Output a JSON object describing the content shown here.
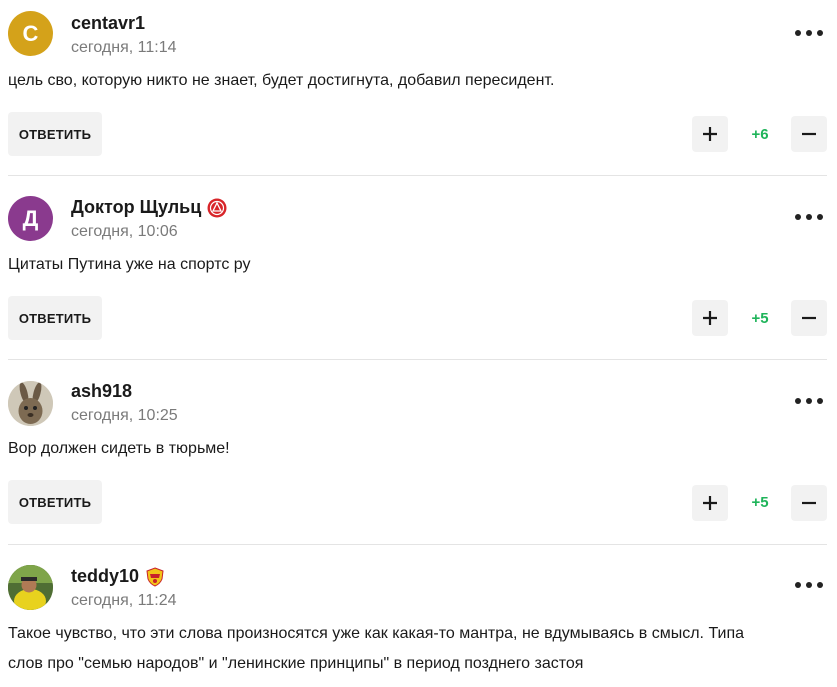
{
  "colors": {
    "accent_green": "#1fb45a",
    "button_bg": "#f2f2f2",
    "muted_text": "#7a7a7a"
  },
  "comments": [
    {
      "avatar_letter": "С",
      "avatar_color": "#d4a21a",
      "username": "centavr1",
      "time": "сегодня, 11:14",
      "text": "цель сво, которую никто не знает, будет достигнута, добавил пересидент.",
      "reply_label": "ОТВЕТИТЬ",
      "score": "+6"
    },
    {
      "avatar_letter": "Д",
      "avatar_color": "#8a3a8e",
      "username": "Доктор Щульц",
      "badge": "red-club-badge-icon",
      "time": "сегодня, 10:06",
      "text": "Цитаты Путина уже на спортс ру",
      "reply_label": "ОТВЕТИТЬ",
      "score": "+5"
    },
    {
      "avatar_letter": "",
      "avatar_color": "#8c7a62",
      "username": "ash918",
      "time": "сегодня, 10:25",
      "text": "Вор должен сидеть в тюрьме!",
      "reply_label": "ОТВЕТИТЬ",
      "score": "+5"
    },
    {
      "avatar_letter": "",
      "avatar_color": "#6f8a3a",
      "username": "teddy10",
      "badge": "yellow-red-club-badge-icon",
      "time": "сегодня, 11:24",
      "text_line1": "Такое чувство, что эти слова произносятся уже как какая-то мантра, не вдумываясь в смысл. Типа",
      "text_line2": "слов про \"семью народов\" и \"ленинские принципы\" в период позднего застоя"
    }
  ]
}
